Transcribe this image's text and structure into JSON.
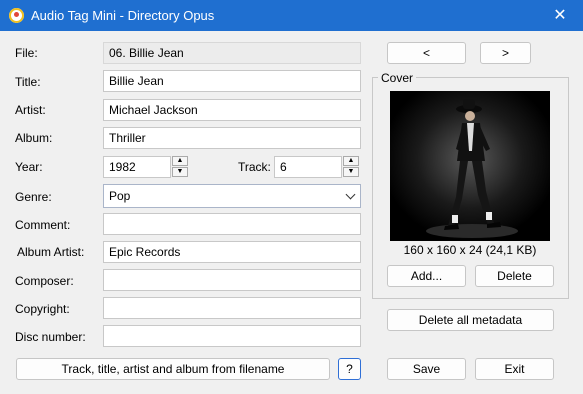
{
  "window": {
    "title": "Audio Tag Mini - Directory Opus",
    "close_glyph": "✕"
  },
  "nav": {
    "prev_label": "<",
    "next_label": ">"
  },
  "fields": {
    "file": {
      "label": "File:",
      "value": "06. Billie Jean"
    },
    "title": {
      "label": "Title:",
      "value": "Billie Jean"
    },
    "artist": {
      "label": "Artist:",
      "value": "Michael Jackson"
    },
    "album": {
      "label": "Album:",
      "value": "Thriller"
    },
    "year": {
      "label": "Year:",
      "value": "1982"
    },
    "track": {
      "label": "Track:",
      "value": "6"
    },
    "genre": {
      "label": "Genre:",
      "value": "Pop"
    },
    "comment": {
      "label": "Comment:",
      "value": ""
    },
    "album_artist": {
      "label": "Album Artist:",
      "value": "Epic Records"
    },
    "composer": {
      "label": "Composer:",
      "value": ""
    },
    "copyright": {
      "label": "Copyright:",
      "value": ""
    },
    "disc_number": {
      "label": "Disc number:",
      "value": ""
    }
  },
  "spinner": {
    "up_glyph": "▲",
    "down_glyph": "▼"
  },
  "cover": {
    "group_label": "Cover",
    "info": "160 x 160 x 24 (24,1 KB)",
    "add_label": "Add...",
    "delete_label": "Delete"
  },
  "buttons": {
    "delete_all_label": "Delete all metadata",
    "from_filename_label": "Track, title, artist and album from filename",
    "help_label": "?",
    "save_label": "Save",
    "exit_label": "Exit"
  },
  "colors": {
    "titlebar": "#1f6fd0",
    "focus_border": "#2f6fd6"
  }
}
